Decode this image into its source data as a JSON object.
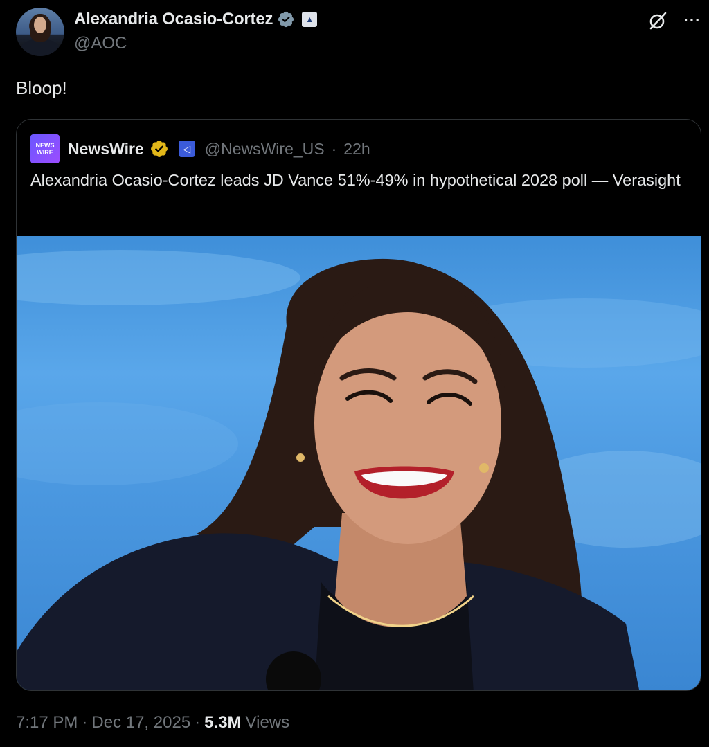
{
  "author": {
    "display_name": "Alexandria Ocasio-Cortez",
    "handle": "@AOC",
    "verified_badge": "blue-check-icon",
    "affiliation_badge": "capitol-icon"
  },
  "tweet": {
    "text": "Bloop!"
  },
  "quoted": {
    "logo_text": "NEWS WIRE",
    "display_name": "NewsWire",
    "verified_badge": "gold-check-icon",
    "affiliation_badge": "newswire-affiliate-icon",
    "handle": "@NewsWire_US",
    "separator": "·",
    "time": "22h",
    "text": "Alexandria Ocasio-Cortez leads JD Vance 51%-49% in hypothetical 2028 poll — Verasight"
  },
  "meta": {
    "time": "7:17 PM",
    "separator": "·",
    "date": "Dec 17, 2025",
    "views_count": "5.3M",
    "views_label": "Views"
  },
  "colors": {
    "background": "#000000",
    "text_primary": "#e7e9ea",
    "text_secondary": "#71767b",
    "border": "#2f3336",
    "verified_blue": "#1d9bf0",
    "verified_gold": "#e2b719"
  }
}
